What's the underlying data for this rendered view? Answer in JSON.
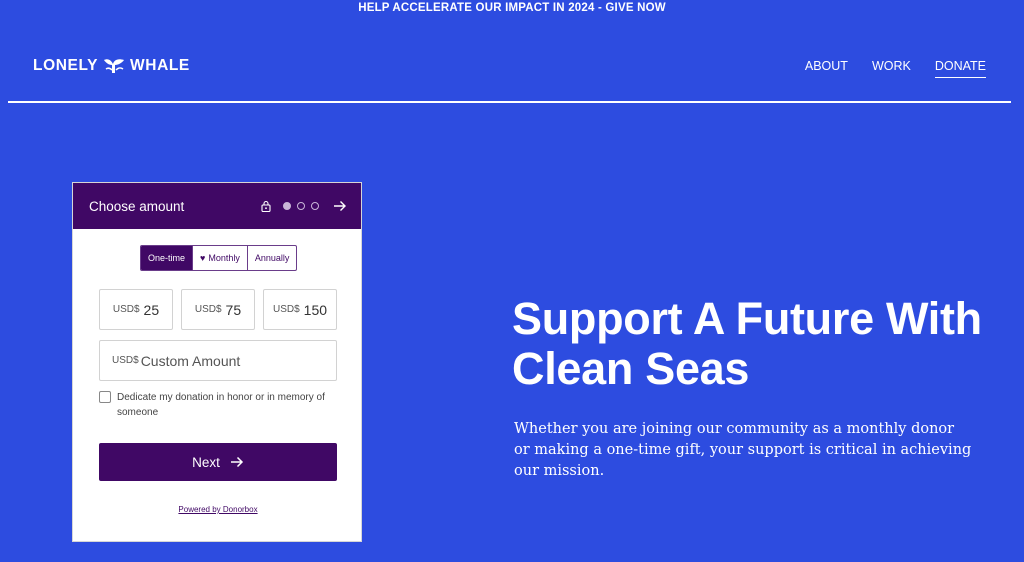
{
  "announcement": "HELP ACCELERATE OUR IMPACT IN 2024 - GIVE NOW",
  "logo": {
    "left_text": "LONELY",
    "right_text": "WHALE",
    "icon": "whale-tail-icon"
  },
  "nav": {
    "items": [
      {
        "label": "ABOUT",
        "active": false
      },
      {
        "label": "WORK",
        "active": false
      },
      {
        "label": "DONATE",
        "active": true
      }
    ]
  },
  "widget": {
    "title": "Choose amount",
    "step_current": 1,
    "step_total": 3,
    "frequency": {
      "selected": "One-time",
      "options": [
        "One-time",
        "Monthly",
        "Annually"
      ]
    },
    "currency": "USD$",
    "amounts": [
      "25",
      "75",
      "150"
    ],
    "custom_placeholder": "Custom Amount",
    "dedicate_label": "Dedicate my donation in honor or in memory of someone",
    "next_label": "Next",
    "powered_by": "Powered by Donorbox",
    "colors": {
      "primary": "#400865"
    }
  },
  "hero": {
    "title": "Support A Future With Clean Seas",
    "text": "Whether you are joining our community as a monthly donor or making a one-time gift, your support is critical in achieving our mission."
  },
  "colors": {
    "background": "#2d4ce0",
    "text": "#ffffff"
  }
}
